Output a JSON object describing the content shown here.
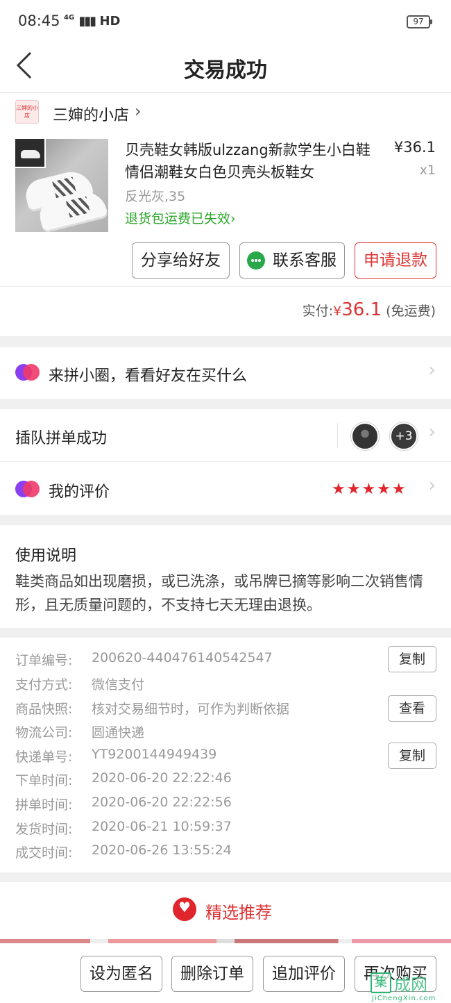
{
  "status": {
    "time": "08:45",
    "network": "4G",
    "hd": "HD",
    "battery": "97"
  },
  "nav": {
    "title": "交易成功"
  },
  "shop": {
    "logo_text": "三婶的小店",
    "name": "三婶的小店"
  },
  "product": {
    "title": "贝壳鞋女韩版ulzzang新款学生小白鞋情侣潮鞋女白色贝壳头板鞋女",
    "price": "¥36.1",
    "qty": "x1",
    "spec": "反光灰,35",
    "return_note": "退货包运费已失效"
  },
  "order_actions": {
    "share": "分享给好友",
    "service": "联系客服",
    "refund": "申请退款"
  },
  "payment": {
    "label": "实付:",
    "currency": "¥",
    "amount": "36.1",
    "note": "(免运费)"
  },
  "circle": {
    "text": "来拼小圈，看看好友在买什么"
  },
  "group": {
    "label": "插队拼单成功",
    "extra_count": "+3"
  },
  "review": {
    "label": "我的评价",
    "stars": "★★★★★",
    "rating": 5
  },
  "notes": {
    "title": "使用说明",
    "text": "鞋类商品如出现磨损，或已洗涤，或吊牌已摘等影响二次销售情形，且无质量问题的，不支持七天无理由退换。"
  },
  "order_info": {
    "rows": [
      {
        "key": "订单编号:",
        "value": "200620-440476140542547"
      },
      {
        "key": "支付方式:",
        "value": "微信支付"
      },
      {
        "key": "商品快照:",
        "value": "核对交易细节时，可作为判断依据"
      },
      {
        "key": "物流公司:",
        "value": "圆通快递"
      },
      {
        "key": "快递单号:",
        "value": "YT9200144949439"
      },
      {
        "key": "下单时间:",
        "value": "2020-06-20 22:22:46"
      },
      {
        "key": "拼单时间:",
        "value": "2020-06-20 22:22:56"
      },
      {
        "key": "发货时间:",
        "value": "2020-06-21 10:59:37"
      },
      {
        "key": "成交时间:",
        "value": "2020-06-26 13:55:24"
      }
    ],
    "copy_order": "复制",
    "view_snapshot": "查看",
    "copy_tracking": "复制"
  },
  "recommend": {
    "text": "精选推荐"
  },
  "bottom_actions": {
    "anonymous": "设为匿名",
    "delete": "删除订单",
    "add_review": "追加评价",
    "rebuy": "再次购买"
  },
  "watermark": {
    "box": "集",
    "text": "成网",
    "url": "JiChengXin.com"
  },
  "colors": {
    "accent_red": "#e0262c",
    "green": "#2aa52a",
    "wechat_green": "#29a84a"
  },
  "icons": [
    "back-icon",
    "chevron-right-icon",
    "chat-icon",
    "pinquan-icon",
    "star-icon",
    "heart-icon"
  ]
}
